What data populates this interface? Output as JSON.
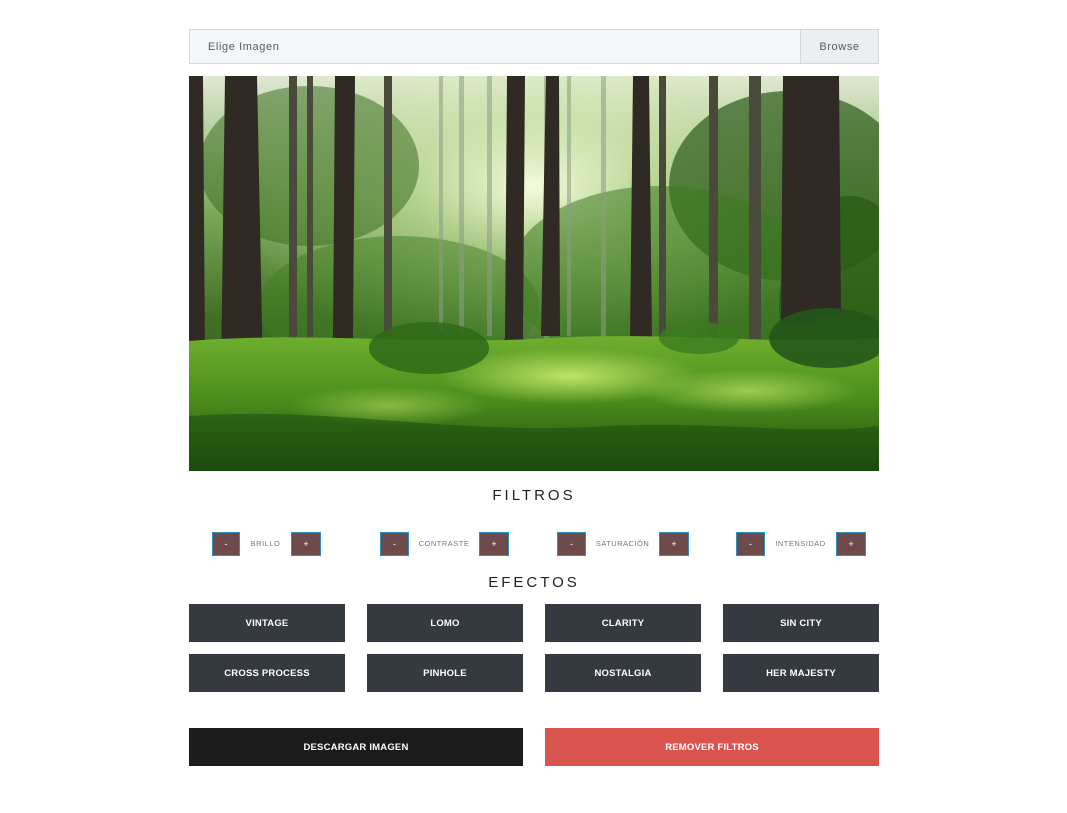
{
  "file_input": {
    "label": "Elige Imagen",
    "browse_label": "Browse"
  },
  "photo": {
    "subject": "sunlit forest with tall trees and grass"
  },
  "filters": {
    "title": "FILTROS",
    "minus": "-",
    "plus": "+",
    "items": [
      {
        "label": "BRILLO"
      },
      {
        "label": "CONTRASTE"
      },
      {
        "label": "SATURACIÓN"
      },
      {
        "label": "INTENSIDAD"
      }
    ]
  },
  "effects": {
    "title": "EFECTOS",
    "items": [
      {
        "label": "VINTAGE"
      },
      {
        "label": "LOMO"
      },
      {
        "label": "CLARITY"
      },
      {
        "label": "SIN CITY"
      },
      {
        "label": "CROSS PROCESS"
      },
      {
        "label": "PINHOLE"
      },
      {
        "label": "NOSTALGIA"
      },
      {
        "label": "HER MAJESTY"
      }
    ]
  },
  "actions": {
    "download_label": "DESCARGAR IMAGEN",
    "remove_label": "REMOVER FILTROS"
  },
  "colors": {
    "effect_button": "#343a40",
    "download_button": "#1b1b1c",
    "remove_button": "#d9534f",
    "adjust_button": "#6e4b4b",
    "adjust_border": "#2f8fbf"
  }
}
